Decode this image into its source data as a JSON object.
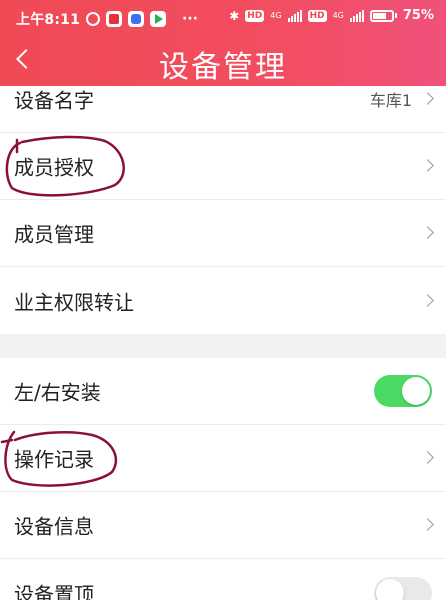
{
  "status_bar": {
    "time": "上午8:11",
    "dots": "···",
    "hd1": "HD",
    "net1": "4G",
    "hd2": "HD",
    "net2": "4G",
    "battery_percent": "75%",
    "battery_level": 0.75
  },
  "header": {
    "title": "设备管理",
    "back_icon": "chevron-left-icon"
  },
  "sections": [
    {
      "rows": [
        {
          "label": "设备名字",
          "value": "车库1",
          "type": "chevron"
        },
        {
          "label": "成员授权",
          "type": "chevron"
        },
        {
          "label": "成员管理",
          "type": "chevron"
        },
        {
          "label": "业主权限转让",
          "type": "chevron"
        }
      ]
    },
    {
      "rows": [
        {
          "label": "左/右安装",
          "type": "toggle",
          "on": true
        },
        {
          "label": "操作记录",
          "type": "chevron"
        },
        {
          "label": "设备信息",
          "type": "chevron"
        },
        {
          "label": "设备置顶",
          "type": "toggle",
          "on": false
        }
      ]
    }
  ],
  "colors": {
    "header_gradient_start": "#f04a55",
    "header_gradient_end": "#f0517a",
    "toggle_on": "#4cd964",
    "annotation": "#8a1136"
  }
}
